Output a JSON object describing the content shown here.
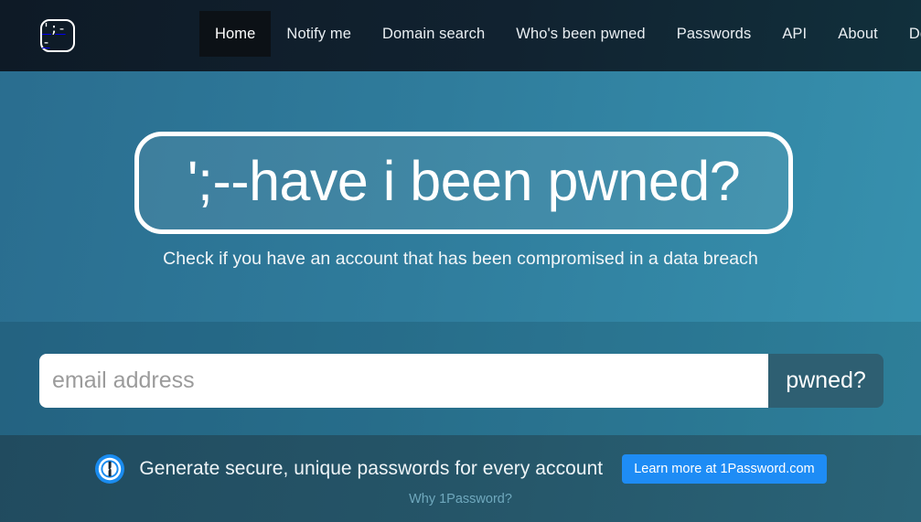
{
  "navbar": {
    "brand": {
      "icon": "hibp-logo-icon",
      "glyph": "';--"
    },
    "items": [
      {
        "label": "Home",
        "active": true
      },
      {
        "label": "Notify me",
        "active": false
      },
      {
        "label": "Domain search",
        "active": false
      },
      {
        "label": "Who's been pwned",
        "active": false
      },
      {
        "label": "Passwords",
        "active": false
      },
      {
        "label": "API",
        "active": false
      },
      {
        "label": "About",
        "active": false
      },
      {
        "label": "Donate",
        "active": false,
        "icons": [
          "bitcoin-icon",
          "paypal-icon"
        ]
      }
    ],
    "donate_bitcoin_glyph": "₿"
  },
  "hero": {
    "title": "';--have i been pwned?",
    "subtitle": "Check if you have an account that has been compromised in a data breach"
  },
  "search": {
    "placeholder": "email address",
    "value": "",
    "button_label": "pwned?"
  },
  "sponsor": {
    "logo_icon": "1password-logo-icon",
    "message": "Generate secure, unique passwords for every account",
    "cta_label": "Learn more at 1Password.com",
    "why_link_label": "Why 1Password?"
  },
  "colors": {
    "navbar_dark": "#0e1a26",
    "active_tab": "#0c1116",
    "hero_gradient_start": "#2a6d8f",
    "hero_gradient_end": "#3792af",
    "pwned_button": "#2e5f72",
    "sponsor_band": "#245265",
    "cta_blue": "#1e8cf5",
    "why_link": "#6fa8bd",
    "placeholder_gray": "#9b9b9b"
  }
}
